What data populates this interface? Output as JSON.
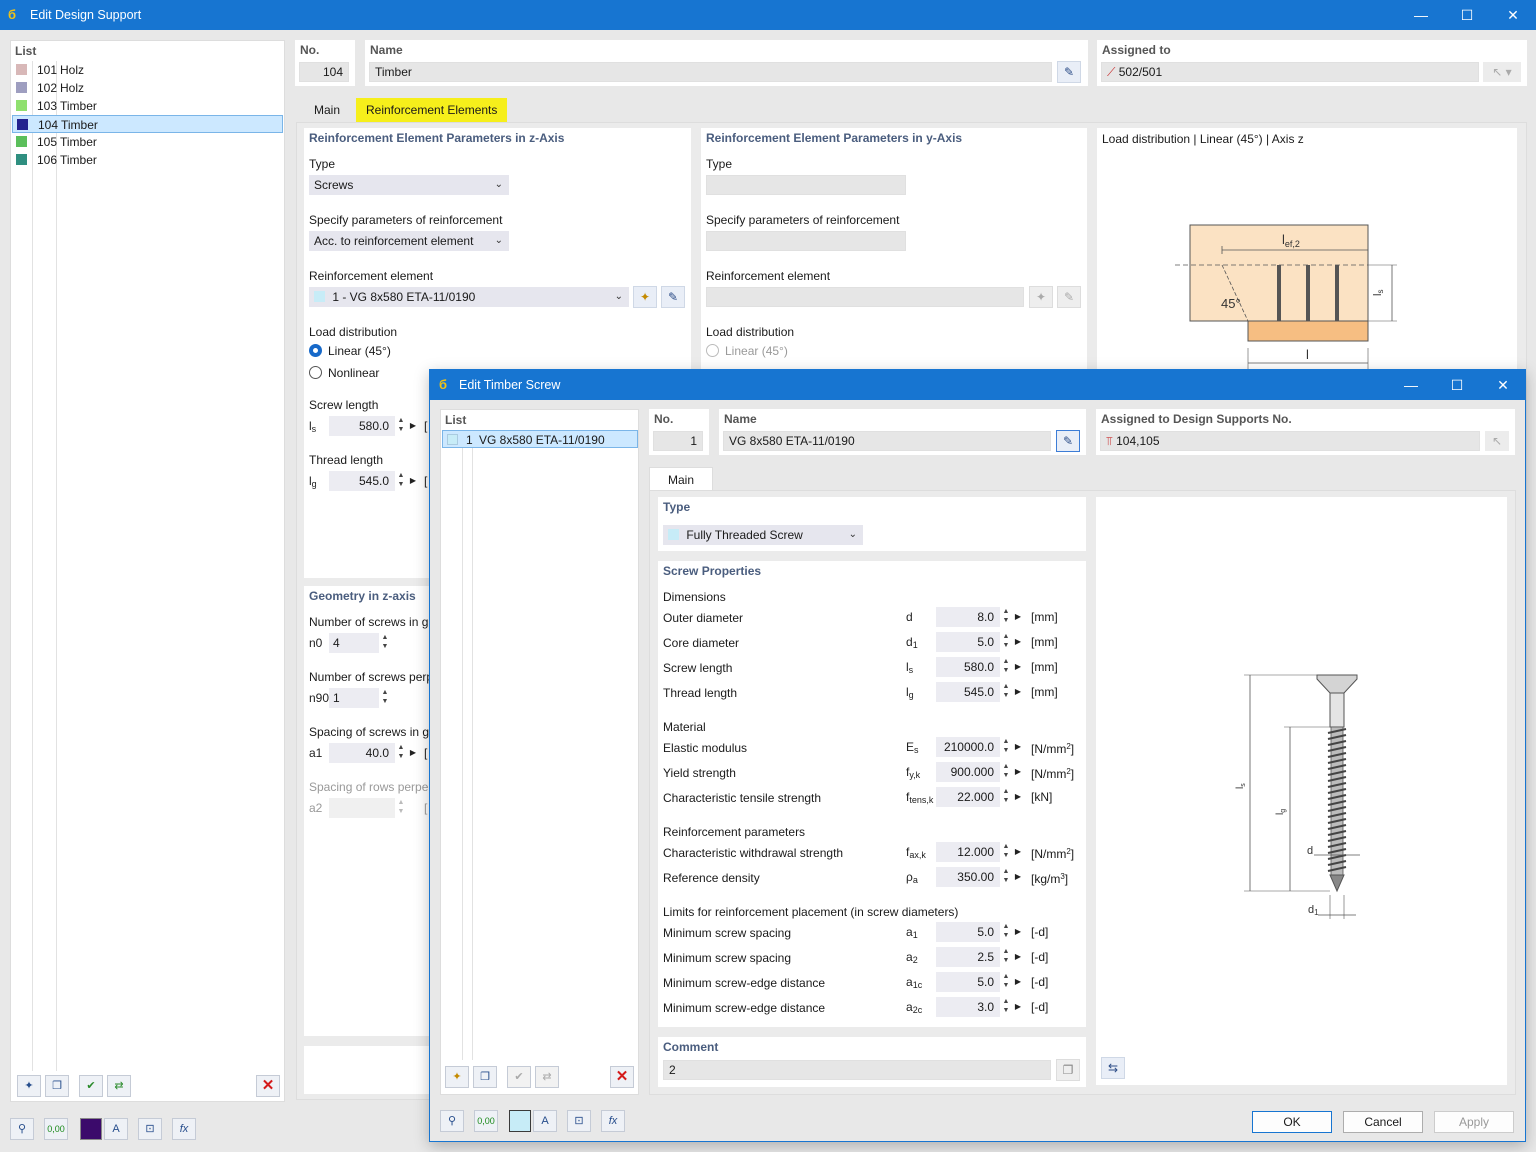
{
  "outer": {
    "title": "Edit Design Support",
    "list_header": "List",
    "list_items": [
      {
        "no": "101",
        "name": "Holz",
        "color": "#d8b8b8"
      },
      {
        "no": "102",
        "name": "Holz",
        "color": "#9e9ec0"
      },
      {
        "no": "103",
        "name": "Timber",
        "color": "#8fe06e"
      },
      {
        "no": "104",
        "name": "Timber",
        "color": "#23238f"
      },
      {
        "no": "105",
        "name": "Timber",
        "color": "#5bbf5b"
      },
      {
        "no": "106",
        "name": "Timber",
        "color": "#2f8f80"
      }
    ],
    "no_label": "No.",
    "no_value": "104",
    "name_label": "Name",
    "name_value": "Timber",
    "assigned_label": "Assigned to",
    "assigned_value": "502/501",
    "tabs": [
      "Main",
      "Reinforcement Elements"
    ],
    "z_axis": {
      "header": "Reinforcement Element Parameters in z-Axis",
      "type_label": "Type",
      "type_value": "Screws",
      "spec_label": "Specify parameters of reinforcement",
      "spec_value": "Acc. to reinforcement element",
      "elem_label": "Reinforcement element",
      "elem_value": "1 - VG 8x580 ETA-11/0190",
      "load_label": "Load distribution",
      "load_linear": "Linear (45°)",
      "load_nonlinear": "Nonlinear",
      "screw_len_label": "Screw length",
      "screw_len_sym": "l",
      "screw_len_sub": "s",
      "screw_len_value": "580.0",
      "unit_trunc": "[",
      "thread_len_label": "Thread length",
      "thread_len_sym": "l",
      "thread_len_sub": "g",
      "thread_len_value": "545.0"
    },
    "y_axis": {
      "header": "Reinforcement Element Parameters in y-Axis",
      "type_label": "Type",
      "spec_label": "Specify parameters of reinforcement",
      "elem_label": "Reinforcement element",
      "load_label": "Load distribution",
      "load_linear": "Linear (45°)"
    },
    "preview_title": "Load distribution | Linear (45°) | Axis z",
    "preview_labels": {
      "lef": "l",
      "lef_sub": "ef,2",
      "angle": "45°",
      "ls": "l",
      "ls_sub": "s",
      "l": "l"
    },
    "geometry": {
      "header": "Geometry in z-axis",
      "n0_label": "Number of screws in gr",
      "n0_sym": "n0",
      "n0_value": "4",
      "n90_label": "Number of screws perp",
      "n90_sym": "n90",
      "n90_value": "1",
      "a1_label": "Spacing of screws in gr",
      "a1_sym": "a1",
      "a1_value": "40.0",
      "a2_label": "Spacing of rows perper",
      "a2_sym": "a2"
    }
  },
  "inner": {
    "title": "Edit Timber Screw",
    "list_header": "List",
    "list_item_no": "1",
    "list_item_name": "VG 8x580 ETA-11/0190",
    "list_item_color": "#c7ecf7",
    "no_label": "No.",
    "no_value": "1",
    "name_label": "Name",
    "name_value": "VG 8x580 ETA-11/0190",
    "assigned_label": "Assigned to Design Supports No.",
    "assigned_value": "104,105",
    "tab": "Main",
    "type_header": "Type",
    "type_value": "Fully Threaded Screw",
    "props_header": "Screw Properties",
    "dims_label": "Dimensions",
    "rows_dims": [
      {
        "label": "Outer diameter",
        "sym": "d",
        "sub": "",
        "value": "8.0",
        "unit": "[mm]",
        "sup": ""
      },
      {
        "label": "Core diameter",
        "sym": "d",
        "sub": "1",
        "value": "5.0",
        "unit": "[mm]",
        "sup": ""
      },
      {
        "label": "Screw length",
        "sym": "l",
        "sub": "s",
        "value": "580.0",
        "unit": "[mm]",
        "sup": ""
      },
      {
        "label": "Thread length",
        "sym": "l",
        "sub": "g",
        "value": "545.0",
        "unit": "[mm]",
        "sup": ""
      }
    ],
    "material_label": "Material",
    "rows_mat": [
      {
        "label": "Elastic modulus",
        "sym": "E",
        "sub": "s",
        "value": "210000.0",
        "unit": "[N/mm",
        "sup": "2",
        "close": "]"
      },
      {
        "label": "Yield strength",
        "sym": "f",
        "sub": "y,k",
        "value": "900.000",
        "unit": "[N/mm",
        "sup": "2",
        "close": "]"
      },
      {
        "label": "Characteristic tensile strength",
        "sym": "f",
        "sub": "tens,k",
        "value": "22.000",
        "unit": "[kN]",
        "sup": "",
        "close": ""
      }
    ],
    "reinf_label": "Reinforcement parameters",
    "rows_reinf": [
      {
        "label": "Characteristic withdrawal strength",
        "sym": "f",
        "sub": "ax,k",
        "value": "12.000",
        "unit": "[N/mm",
        "sup": "2",
        "close": "]"
      },
      {
        "label": "Reference density",
        "sym": "ρ",
        "sub": "a",
        "value": "350.00",
        "unit": "[kg/m",
        "sup": "3",
        "close": "]"
      }
    ],
    "limits_label": "Limits for reinforcement placement (in screw diameters)",
    "rows_limits": [
      {
        "label": "Minimum screw spacing",
        "sym": "a",
        "sub": "1",
        "value": "5.0",
        "unit": "[-d]"
      },
      {
        "label": "Minimum screw spacing",
        "sym": "a",
        "sub": "2",
        "value": "2.5",
        "unit": "[-d]"
      },
      {
        "label": "Minimum screw-edge distance",
        "sym": "a",
        "sub": "1c",
        "value": "5.0",
        "unit": "[-d]"
      },
      {
        "label": "Minimum screw-edge distance",
        "sym": "a",
        "sub": "2c",
        "value": "3.0",
        "unit": "[-d]"
      }
    ],
    "comment_label": "Comment",
    "comment_value": "2",
    "drawing_labels": {
      "ls": "l",
      "ls_sub": "s",
      "lg": "l",
      "lg_sub": "g",
      "d": "d",
      "d1": "d",
      "d1_sub": "1"
    },
    "ok": "OK",
    "cancel": "Cancel",
    "apply": "Apply",
    "zero_label": "0,00"
  }
}
